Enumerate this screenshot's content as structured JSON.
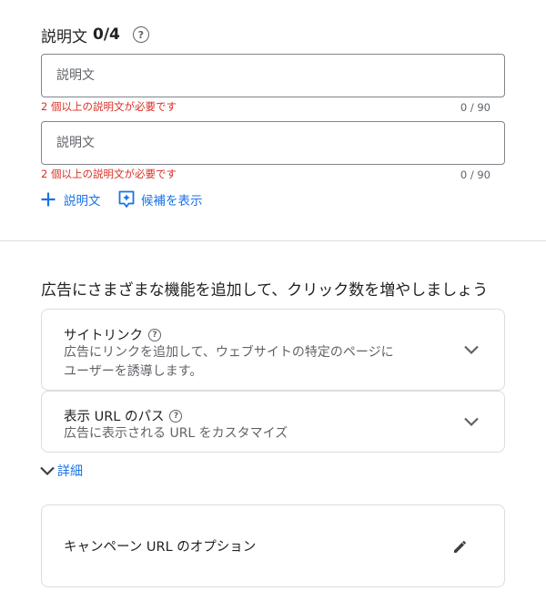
{
  "descriptions": {
    "title": "説明文",
    "count": "0/4",
    "inputs": [
      {
        "placeholder": "説明文",
        "value": "",
        "error": "2 個以上の説明文が必要です",
        "char_count": "0 / 90"
      },
      {
        "placeholder": "説明文",
        "value": "",
        "error": "2 個以上の説明文が必要です",
        "char_count": "0 / 90"
      }
    ],
    "add_label": "説明文",
    "suggest_label": "候補を表示"
  },
  "features": {
    "heading": "広告にさまざまな機能を追加して、クリック数を増やしましょう",
    "sitelinks": {
      "title": "サイトリンク",
      "desc_line1": "広告にリンクを追加して、ウェブサイトの特定のページに",
      "desc_line2": "ユーザーを誘導します。"
    },
    "display_path": {
      "title": "表示 URL のパス",
      "desc": "広告に表示される URL をカスタマイズ"
    },
    "more_label": "詳細"
  },
  "campaign_url": {
    "title": "キャンペーン URL のオプション"
  },
  "colors": {
    "accent": "#1a73e8",
    "error": "#d93025",
    "border": "#dadce0",
    "input_border": "#80868b",
    "text_secondary": "#5f6368"
  }
}
